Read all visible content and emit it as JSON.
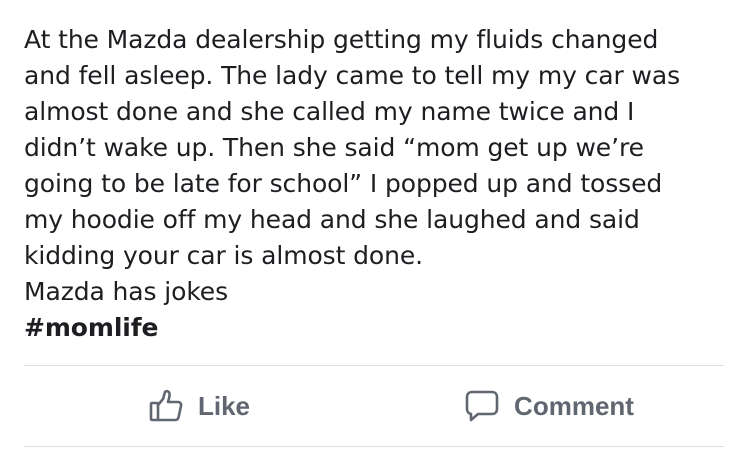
{
  "post": {
    "lines": [
      "At the Mazda dealership getting my fluids changed",
      "and fell asleep. The lady came to tell my my car was",
      "almost done and she called my name twice and I",
      "didn’t wake up. Then she said “mom get up we’re",
      "going to be late for school” I popped up and tossed",
      "my hoodie off my head and she laughed and said",
      "kidding your car is almost done.",
      "Mazda has jokes"
    ],
    "hashtag": "#momlife"
  },
  "actions": {
    "like_label": "Like",
    "like_icon": "thumbs-up-icon",
    "comment_label": "Comment",
    "comment_icon": "speech-bubble-icon"
  },
  "colors": {
    "text": "#1c1e21",
    "action_text": "#606770",
    "divider": "#dadde1"
  }
}
